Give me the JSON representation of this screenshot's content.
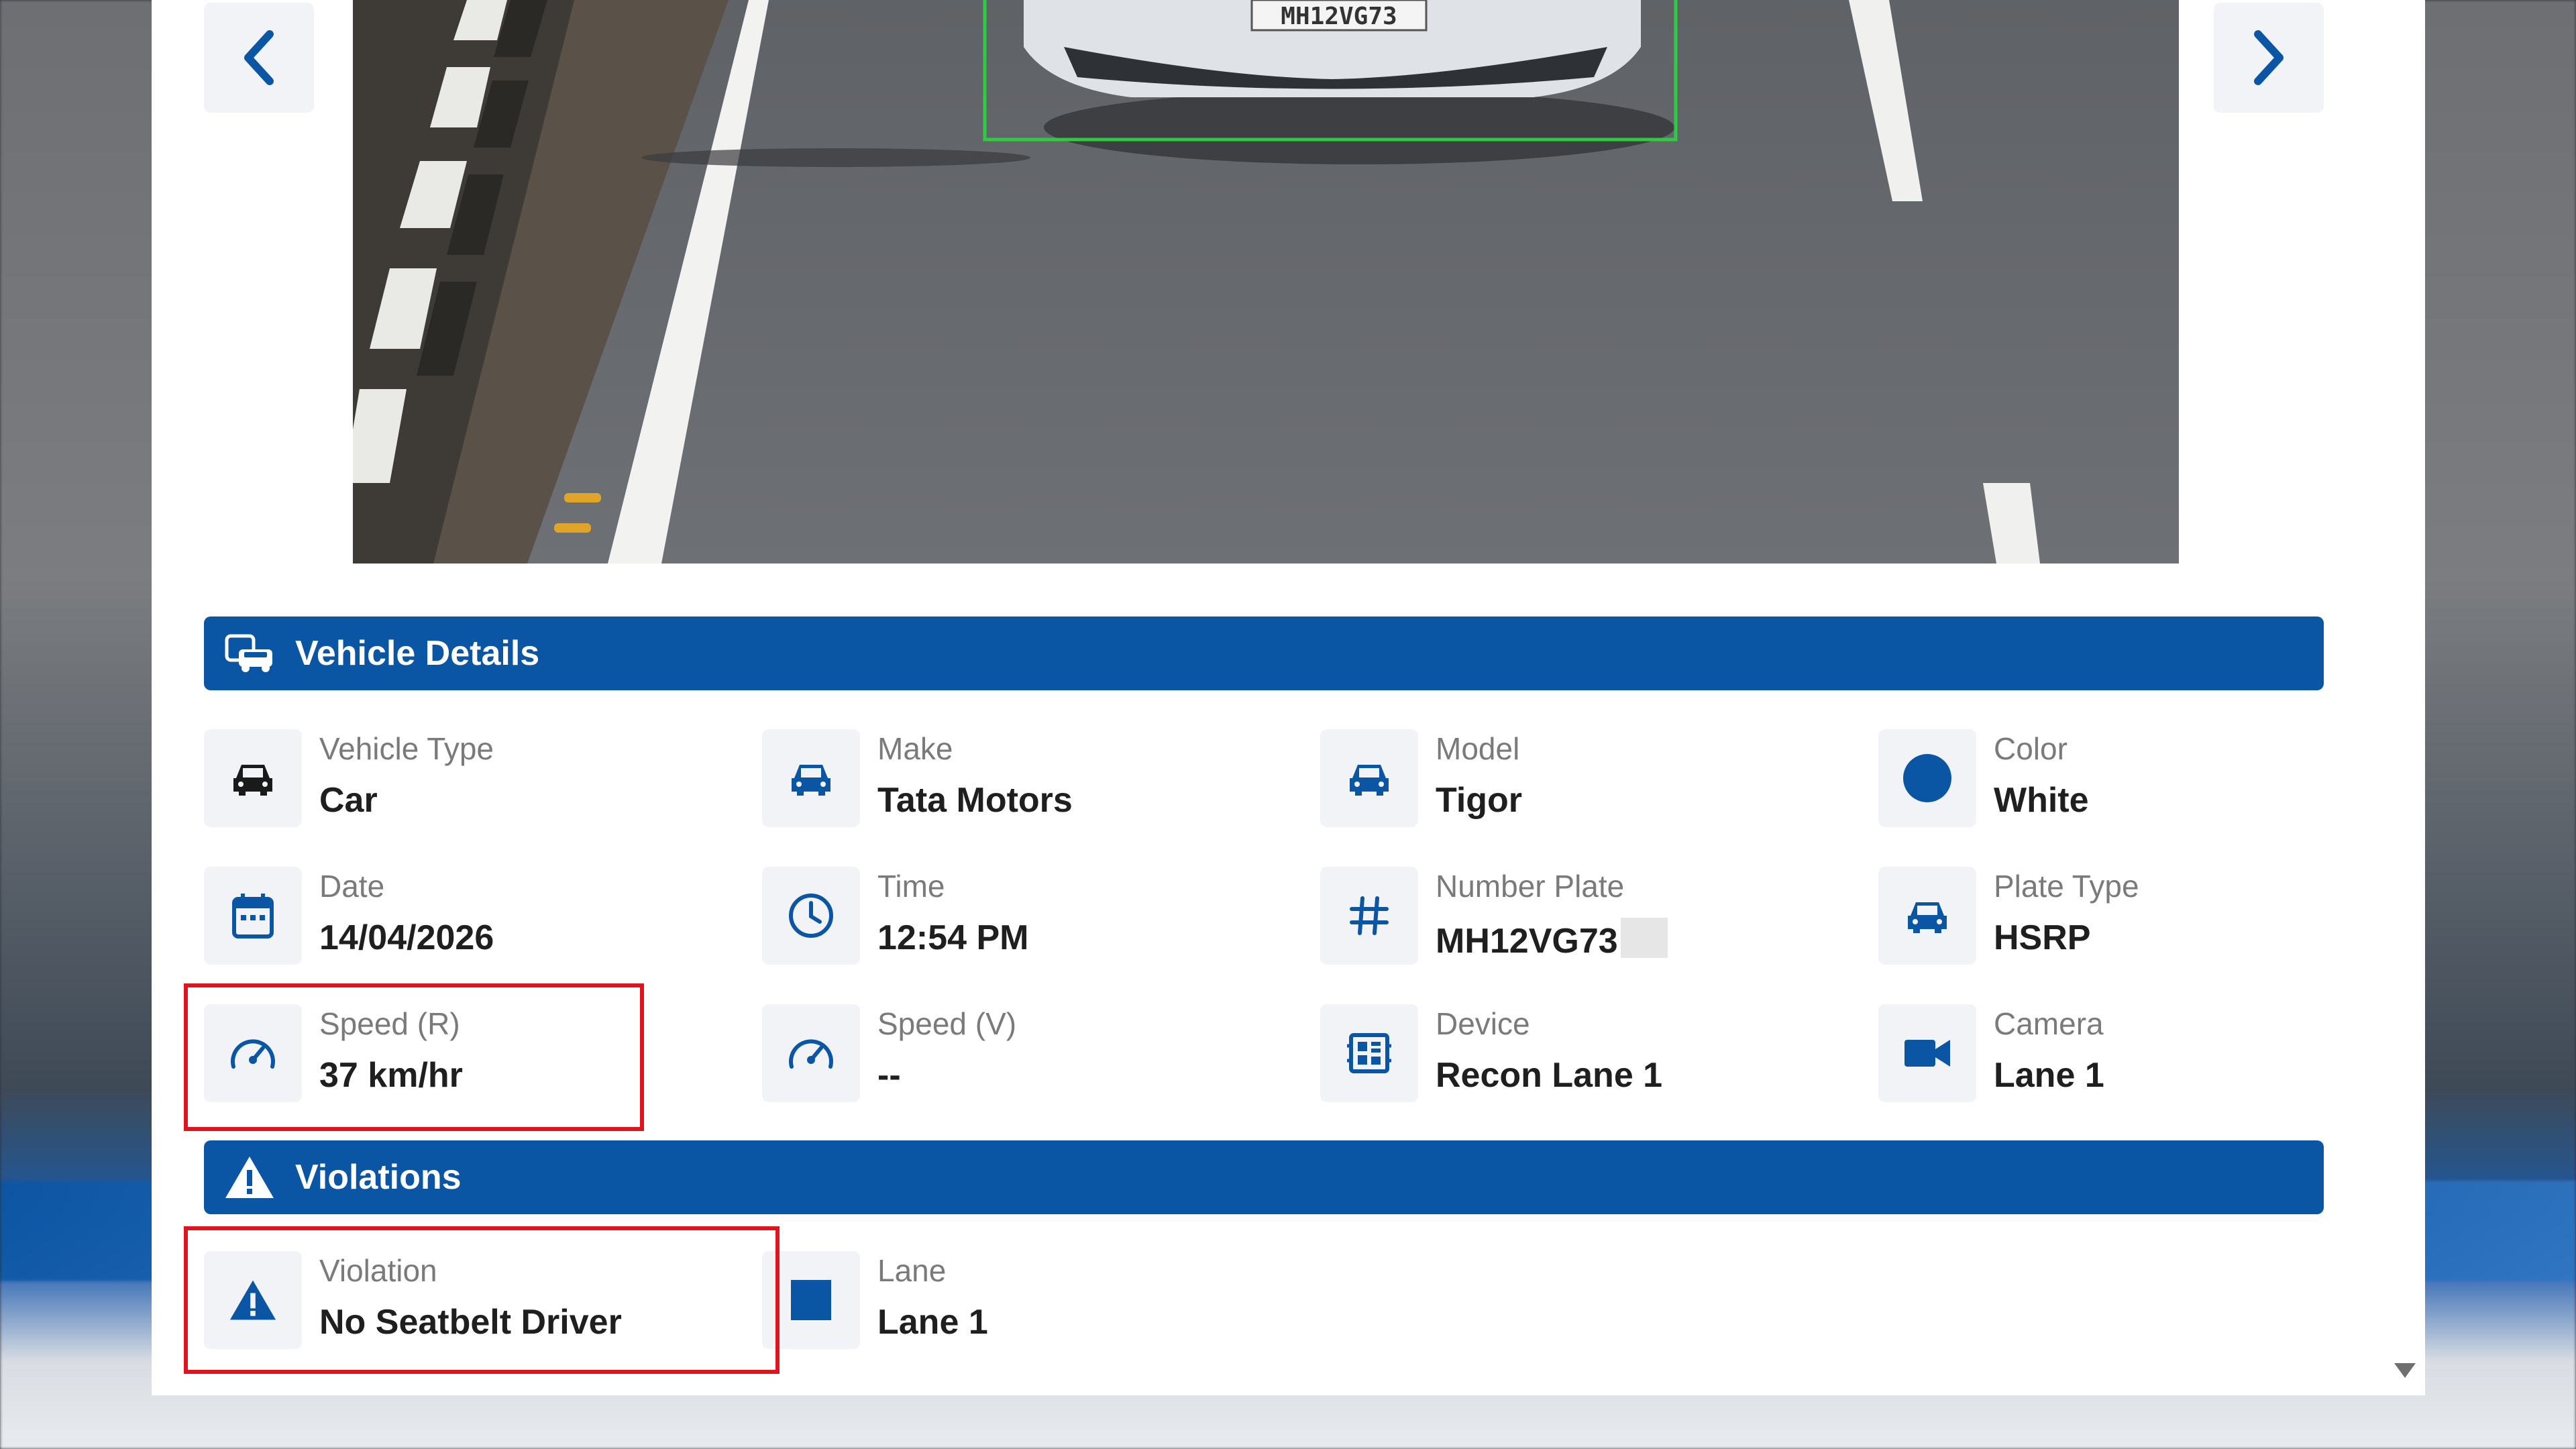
{
  "colors": {
    "accent": "#0b56a4",
    "highlight": "#e0141e",
    "detection_box": "#2ecc40"
  },
  "photo": {
    "plate_text": "MH12VG73"
  },
  "navigation": {
    "prev_icon": "chevron-left-icon",
    "next_icon": "chevron-right-icon"
  },
  "vehicle_details": {
    "title": "Vehicle Details",
    "icon": "vehicle-details-icon",
    "fields": [
      {
        "label": "Vehicle Type",
        "value": "Car",
        "icon": "car-icon"
      },
      {
        "label": "Make",
        "value": "Tata Motors",
        "icon": "car-front-icon"
      },
      {
        "label": "Model",
        "value": "Tigor",
        "icon": "car-front-icon"
      },
      {
        "label": "Color",
        "value": "White",
        "icon": "circle-icon"
      },
      {
        "label": "Date",
        "value": "14/04/2026",
        "icon": "calendar-icon"
      },
      {
        "label": "Time",
        "value": "12:54 PM",
        "icon": "clock-icon"
      },
      {
        "label": "Number Plate",
        "value": "MH12VG73",
        "icon": "hash-icon"
      },
      {
        "label": "Plate Type",
        "value": "HSRP",
        "icon": "car-front-icon"
      },
      {
        "label": "Speed (R)",
        "value": "37 km/hr",
        "icon": "speedometer-icon"
      },
      {
        "label": "Speed (V)",
        "value": "--",
        "icon": "speedometer-icon"
      },
      {
        "label": "Device",
        "value": "Recon Lane 1",
        "icon": "device-icon"
      },
      {
        "label": "Camera",
        "value": "Lane 1",
        "icon": "video-camera-icon"
      }
    ]
  },
  "violations": {
    "title": "Violations",
    "icon": "warning-icon",
    "fields": [
      {
        "label": "Violation",
        "value": "No Seatbelt Driver",
        "icon": "warning-icon"
      },
      {
        "label": "Lane",
        "value": "Lane 1",
        "icon": "square-icon"
      }
    ]
  }
}
